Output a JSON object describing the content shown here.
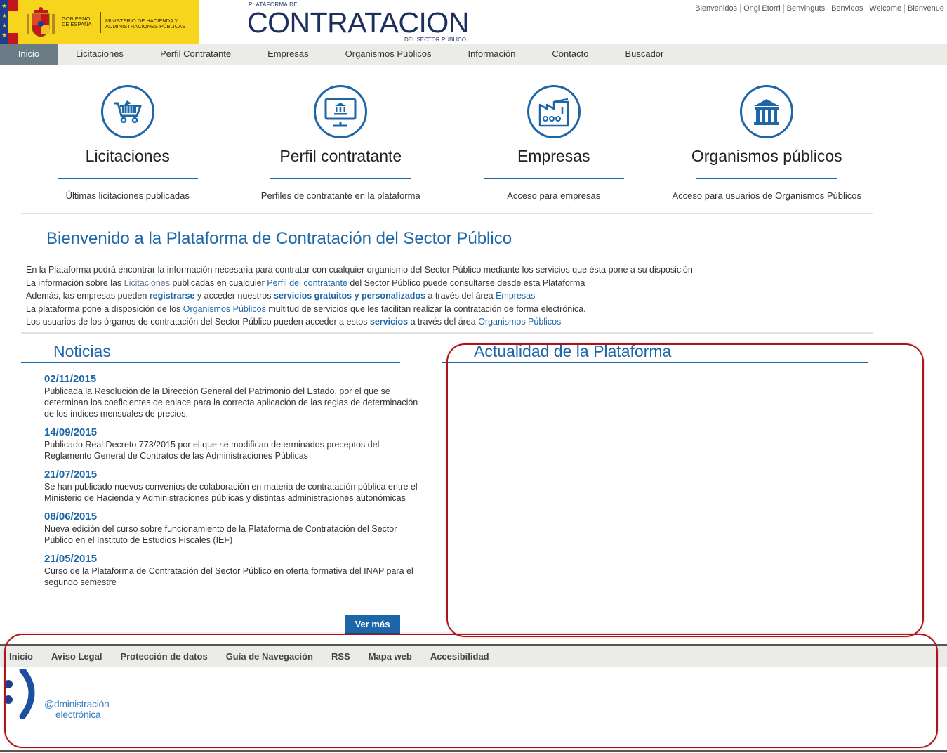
{
  "header": {
    "gov_line1": "Gobierno de España",
    "gov_line2": "Ministerio de Hacienda y Administraciones Públicas",
    "plat_small": "PLATAFORMA DE",
    "plat_big": "CONTRATACION",
    "plat_sub": "DEL SECTOR PÚBLICO",
    "languages": [
      "Bienvenidos",
      "Ongi Etorri",
      "Benvinguts",
      "Benvidos",
      "Welcome",
      "Bienvenue"
    ]
  },
  "nav": [
    "Inicio",
    "Licitaciones",
    "Perfil Contratante",
    "Empresas",
    "Organismos Públicos",
    "Información",
    "Contacto",
    "Buscador"
  ],
  "services": [
    {
      "title": "Licitaciones",
      "desc": "Últimas licitaciones publicadas",
      "icon": "shopping-cart-icon"
    },
    {
      "title": "Perfil contratante",
      "desc": "Perfiles de contratante en la plataforma",
      "icon": "monitor-icon"
    },
    {
      "title": "Empresas",
      "desc": "Acceso para empresas",
      "icon": "factory-icon"
    },
    {
      "title": "Organismos públicos",
      "desc": "Acceso para usuarios de Organismos Públicos",
      "icon": "institution-icon"
    }
  ],
  "welcome": {
    "title": "Bienvenido a la Plataforma de Contratación del Sector Público",
    "l1": "En la Plataforma podrá encontrar la información necesaria para contratar con cualquier organismo del Sector Público mediante los servicios que ésta pone a su disposición",
    "l2a": "La información sobre las ",
    "l2b": "Licitaciones",
    "l2c": " publicadas en cualquier ",
    "l2d": "Perfil del contratante",
    "l2e": " del Sector Público puede consultarse desde esta Plataforma",
    "l3a": "Además, las empresas pueden ",
    "l3b": "registrarse",
    "l3c": " y acceder nuestros ",
    "l3d": "servicios gratuitos y personalizados",
    "l3e": " a través del área ",
    "l3f": "Empresas",
    "l4a": "La plataforma pone a disposición de los ",
    "l4b": "Organismos Públicos",
    "l4c": " multitud de servicios que les facilitan realizar la contratación de forma electrónica.",
    "l5a": "Los usuarios de los órganos de contratación del Sector Público pueden acceder a estos ",
    "l5b": "servicios",
    "l5c": " a través del área ",
    "l5d": "Organismos Públicos"
  },
  "news": {
    "title": "Noticias",
    "items": [
      {
        "date": "02/11/2015",
        "text": "Publicada la Resolución de la Dirección General del Patrimonio del Estado, por el que se determinan los coeficientes de enlace para la correcta aplicación de las reglas de determinación de los índices mensuales de precios."
      },
      {
        "date": "14/09/2015",
        "text": "Publicado Real Decreto 773/2015 por el que se modifican determinados preceptos del Reglamento General de Contratos de las Administraciones Públicas"
      },
      {
        "date": "21/07/2015",
        "text": "Se han publicado nuevos convenios de colaboración en materia de contratación pública entre el Ministerio de Hacienda y Administraciones públicas y distintas administraciones autonómicas"
      },
      {
        "date": "08/06/2015",
        "text": "Nueva edición del curso sobre funcionamiento de la Plataforma de Contratación del Sector Público en el Instituto de Estudios Fiscales (IEF)"
      },
      {
        "date": "21/05/2015",
        "text": "Curso de la Plataforma de Contratación del Sector Público en oferta formativa del INAP para el segundo semestre"
      }
    ],
    "more_label": "Ver más"
  },
  "actualidad": {
    "title": "Actualidad de la Plataforma"
  },
  "footer": {
    "nav": [
      "Inicio",
      "Aviso Legal",
      "Protección de datos",
      "Guía de Navegación",
      "RSS",
      "Mapa web",
      "Accesibilidad"
    ],
    "ae_line1": "@dministración",
    "ae_line2": "electrónica"
  },
  "colors": {
    "brand_blue": "#1d66a8",
    "nav_active": "#6c7c86",
    "annotation_red": "#a8151c"
  }
}
